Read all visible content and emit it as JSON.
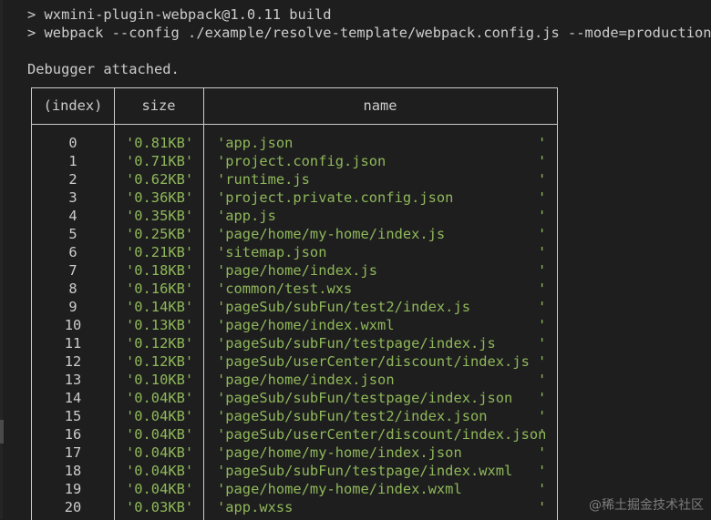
{
  "terminal": {
    "prompt_line_1": "> wxmini-plugin-webpack@1.0.11 build",
    "prompt_line_2": "> webpack --config ./example/resolve-template/webpack.config.js --mode=production",
    "debugger_line": "Debugger attached."
  },
  "table": {
    "headers": [
      "(index)",
      "size",
      "name"
    ],
    "rows": [
      {
        "index": "0",
        "size": "'0.81KB'",
        "name": "'app.json"
      },
      {
        "index": "1",
        "size": "'0.71KB'",
        "name": "'project.config.json"
      },
      {
        "index": "2",
        "size": "'0.62KB'",
        "name": "'runtime.js"
      },
      {
        "index": "3",
        "size": "'0.36KB'",
        "name": "'project.private.config.json"
      },
      {
        "index": "4",
        "size": "'0.35KB'",
        "name": "'app.js"
      },
      {
        "index": "5",
        "size": "'0.25KB'",
        "name": "'page/home/my-home/index.js"
      },
      {
        "index": "6",
        "size": "'0.21KB'",
        "name": "'sitemap.json"
      },
      {
        "index": "7",
        "size": "'0.18KB'",
        "name": "'page/home/index.js"
      },
      {
        "index": "8",
        "size": "'0.16KB'",
        "name": "'common/test.wxs"
      },
      {
        "index": "9",
        "size": "'0.14KB'",
        "name": "'pageSub/subFun/test2/index.js"
      },
      {
        "index": "10",
        "size": "'0.13KB'",
        "name": "'page/home/index.wxml"
      },
      {
        "index": "11",
        "size": "'0.12KB'",
        "name": "'pageSub/subFun/testpage/index.js"
      },
      {
        "index": "12",
        "size": "'0.12KB'",
        "name": "'pageSub/userCenter/discount/index.js"
      },
      {
        "index": "13",
        "size": "'0.10KB'",
        "name": "'page/home/index.json"
      },
      {
        "index": "14",
        "size": "'0.04KB'",
        "name": "'pageSub/subFun/testpage/index.json"
      },
      {
        "index": "15",
        "size": "'0.04KB'",
        "name": "'pageSub/subFun/test2/index.json"
      },
      {
        "index": "16",
        "size": "'0.04KB'",
        "name": "'pageSub/userCenter/discount/index.json"
      },
      {
        "index": "17",
        "size": "'0.04KB'",
        "name": "'page/home/my-home/index.json"
      },
      {
        "index": "18",
        "size": "'0.04KB'",
        "name": "'pageSub/subFun/testpage/index.wxml"
      },
      {
        "index": "19",
        "size": "'0.04KB'",
        "name": "'page/home/my-home/index.wxml"
      },
      {
        "index": "20",
        "size": "'0.03KB'",
        "name": "'app.wxss"
      }
    ],
    "closing_quote": "'"
  },
  "watermark": "@稀土掘金技术社区",
  "colors": {
    "background": "#1e1e1e",
    "text": "#cccccc",
    "string": "#8fb85a"
  }
}
